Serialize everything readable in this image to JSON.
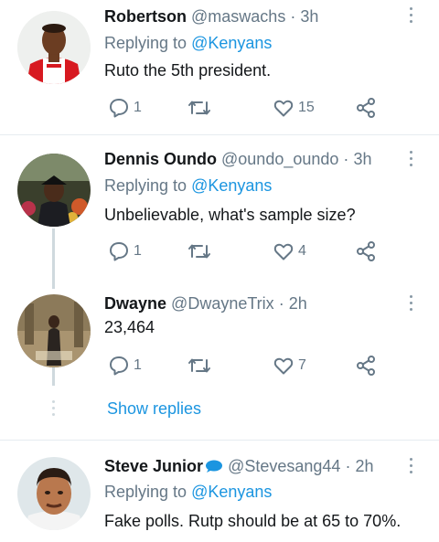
{
  "tweets": [
    {
      "name": "Robertson",
      "handle": "@maswachs",
      "time": "3h",
      "replying_prefix": "Replying to",
      "replying_to": "@Kenyans",
      "text": "Ruto the 5th president.",
      "replies": "1",
      "retweets": "",
      "likes": "15",
      "avatar": "arsenal-jersey-avatar"
    },
    {
      "name": "Dennis Oundo",
      "handle": "@oundo_oundo",
      "time": "3h",
      "replying_prefix": "Replying to",
      "replying_to": "@Kenyans",
      "text": "Unbelievable, what's sample size?",
      "replies": "1",
      "retweets": "",
      "likes": "4",
      "avatar": "child-photo-avatar"
    },
    {
      "name": "Dwayne",
      "handle": "@DwayneTrix",
      "time": "2h",
      "text": "23,464",
      "replies": "1",
      "retweets": "",
      "likes": "7",
      "avatar": "portrait-photo-avatar"
    },
    {
      "name": "Steve Junior",
      "handle": "@Stevesang44",
      "time": "2h",
      "replying_prefix": "Replying to",
      "replying_to": "@Kenyans",
      "text": "Fake polls. Rutp should be at 65 to 70%.",
      "avatar": "cartoon-man-avatar"
    }
  ],
  "show_replies_label": "Show replies",
  "separator": "·",
  "colors": {
    "accent": "#1b95e0",
    "muted": "#657786",
    "divider": "#e6ecf0",
    "thread_line": "#cfd9de"
  }
}
